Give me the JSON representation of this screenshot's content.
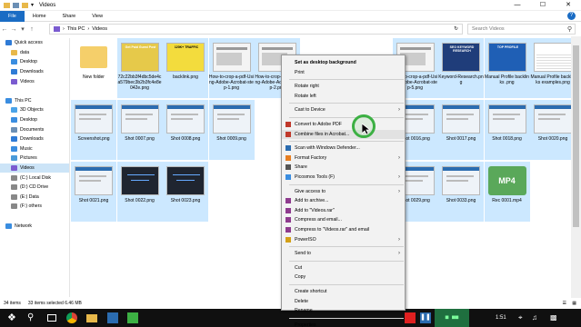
{
  "window": {
    "title": "Videos"
  },
  "ribbon": {
    "tabs": [
      "File",
      "Home",
      "Share",
      "View"
    ],
    "help": "?"
  },
  "address": {
    "path": [
      "This PC",
      "Videos"
    ],
    "search_placeholder": "Search Videos"
  },
  "nav": {
    "items": [
      {
        "label": "Quick access",
        "indent": 0,
        "color": "#2f7bd6"
      },
      {
        "label": "data",
        "indent": 1,
        "color": "#e8b84a"
      },
      {
        "label": "Desktop",
        "indent": 1,
        "color": "#3a8de0"
      },
      {
        "label": "Downloads",
        "indent": 1,
        "color": "#2f7bd6"
      },
      {
        "label": "Videos",
        "indent": 1,
        "color": "#7a5bd0"
      },
      {
        "label": "",
        "indent": 0,
        "color": ""
      },
      {
        "label": "This PC",
        "indent": 0,
        "color": "#3a8de0"
      },
      {
        "label": "3D Objects",
        "indent": 1,
        "color": "#4aa3e8"
      },
      {
        "label": "Desktop",
        "indent": 1,
        "color": "#3a8de0"
      },
      {
        "label": "Documents",
        "indent": 1,
        "color": "#6b8fb5"
      },
      {
        "label": "Downloads",
        "indent": 1,
        "color": "#2f7bd6"
      },
      {
        "label": "Music",
        "indent": 1,
        "color": "#3a8de0"
      },
      {
        "label": "Pictures",
        "indent": 1,
        "color": "#4a9ad9"
      },
      {
        "label": "Videos",
        "indent": 1,
        "color": "#7a5bd0",
        "selected": true
      },
      {
        "label": "(C:) Local Disk",
        "indent": 1,
        "color": "#888888"
      },
      {
        "label": "(D:) CD Drive",
        "indent": 1,
        "color": "#888888"
      },
      {
        "label": "(E:) Data",
        "indent": 1,
        "color": "#888888"
      },
      {
        "label": "(F:) others",
        "indent": 1,
        "color": "#888888"
      },
      {
        "label": "",
        "indent": 0,
        "color": ""
      },
      {
        "label": "Network",
        "indent": 0,
        "color": "#3a8de0"
      }
    ]
  },
  "files": [
    {
      "name": "New folder",
      "kind": "folder",
      "selected": false
    },
    {
      "name": "72c22bb3f4dbc5de4ca579bec3b2b3fc4e8e042e.png",
      "kind": "ad",
      "selected": true
    },
    {
      "name": "backlink.png",
      "kind": "yellow",
      "selected": true
    },
    {
      "name": "How-to-crop-a-pdf-Using-Adobe-Acrobat-step-1.png",
      "kind": "doc",
      "selected": true
    },
    {
      "name": "How-to-crop-a-pdf-Using-Adobe-Acrobat-step-2.png",
      "kind": "doc",
      "selected": true
    },
    {
      "name": "",
      "kind": "hidden",
      "selected": true
    },
    {
      "name": "",
      "kind": "hidden",
      "selected": true
    },
    {
      "name": "How-to-crop-a-pdf-Using-Adobe-Acrobat-step-5.png",
      "kind": "doc",
      "selected": true
    },
    {
      "name": "Keyword-Research.png",
      "kind": "keyword",
      "selected": true
    },
    {
      "name": "Manual Profile backlinks .png",
      "kind": "blue",
      "selected": true
    },
    {
      "name": "Manual Profile backlinks examples.png",
      "kind": "table",
      "selected": true
    },
    {
      "name": "Screenshot.png",
      "kind": "screen",
      "selected": true
    },
    {
      "name": "Shot 0007.png",
      "kind": "screen",
      "selected": true
    },
    {
      "name": "Shot 0008.png",
      "kind": "screen",
      "selected": true
    },
    {
      "name": "Shot 0009.png",
      "kind": "screen",
      "selected": true
    },
    {
      "name": "",
      "kind": "hidden",
      "selected": true
    },
    {
      "name": "",
      "kind": "hidden",
      "selected": true
    },
    {
      "name": "Shot 0013.png",
      "kind": "screen",
      "selected": true
    },
    {
      "name": "Shot 0016.png",
      "kind": "screen",
      "selected": true
    },
    {
      "name": "Shot 0017.png",
      "kind": "screen",
      "selected": true
    },
    {
      "name": "Shot 0018.png",
      "kind": "screen",
      "selected": true
    },
    {
      "name": "Shot 0020.png",
      "kind": "screen",
      "selected": true
    },
    {
      "name": "Shot 0021.png",
      "kind": "screen",
      "selected": true
    },
    {
      "name": "Shot 0022.png",
      "kind": "dark",
      "selected": true
    },
    {
      "name": "Shot 0023.png",
      "kind": "dark",
      "selected": true
    },
    {
      "name": "",
      "kind": "hidden",
      "selected": true
    },
    {
      "name": "",
      "kind": "hidden",
      "selected": true
    },
    {
      "name": "Shot 0027.png",
      "kind": "screen",
      "selected": true
    },
    {
      "name": "Shot 0028.png",
      "kind": "screen",
      "selected": true
    },
    {
      "name": "Shot 0029.png",
      "kind": "screen",
      "selected": true
    },
    {
      "name": "Shot 0033.png",
      "kind": "screen",
      "selected": true
    },
    {
      "name": "Rec 0001.mp4",
      "kind": "mp4",
      "selected": true
    }
  ],
  "thumb_text": {
    "ad": "Get Paid Guest Post",
    "yellow": "120K+ TRAFFIC",
    "keyword": "SEO KEYWORD RESEARCH",
    "blue": "TOP PROFILE",
    "table": "BACKLINKS",
    "mp4": "MP4"
  },
  "context_menu": {
    "items": [
      {
        "label": "Set as desktop background",
        "bold": true
      },
      {
        "label": "Print"
      },
      {
        "sep": true
      },
      {
        "label": "Rotate right"
      },
      {
        "label": "Rotate left"
      },
      {
        "sep": true
      },
      {
        "label": "Cast to Device",
        "sub": true
      },
      {
        "sep": true
      },
      {
        "label": "Convert to Adobe PDF",
        "icon": "#c0392b"
      },
      {
        "label": "Combine files in Acrobat...",
        "icon": "#c0392b",
        "highlight": true
      },
      {
        "sep": true
      },
      {
        "label": "Scan with Windows Defender...",
        "icon": "#2b6cb0"
      },
      {
        "label": "Format Factory",
        "sub": true,
        "icon": "#e67e22"
      },
      {
        "label": "Share",
        "icon": "#555555"
      },
      {
        "label": "Picosmos Tools (F)",
        "sub": true,
        "icon": "#3a8de0"
      },
      {
        "sep": true
      },
      {
        "label": "Give access to",
        "sub": true
      },
      {
        "label": "Add to archive...",
        "icon": "#8e3b8e"
      },
      {
        "label": "Add to \"Videos.rar\"",
        "icon": "#8e3b8e"
      },
      {
        "label": "Compress and email...",
        "icon": "#8e3b8e"
      },
      {
        "label": "Compress to \"Videos.rar\" and email",
        "icon": "#8e3b8e"
      },
      {
        "label": "PowerISO",
        "sub": true,
        "icon": "#d4a017"
      },
      {
        "sep": true
      },
      {
        "label": "Send to",
        "sub": true
      },
      {
        "sep": true
      },
      {
        "label": "Cut"
      },
      {
        "label": "Copy"
      },
      {
        "sep": true
      },
      {
        "label": "Create shortcut"
      },
      {
        "label": "Delete"
      },
      {
        "label": "Rename"
      },
      {
        "sep": true
      },
      {
        "label": "Properties"
      }
    ]
  },
  "status": {
    "count": "34 items",
    "selection": "33 items selected  6.46 MB"
  },
  "taskbar": {
    "clock": "1:51"
  },
  "colors": {
    "accent": "#1a6cc4",
    "selection": "#cce8ff",
    "cursor_ring": "#3cb043"
  }
}
